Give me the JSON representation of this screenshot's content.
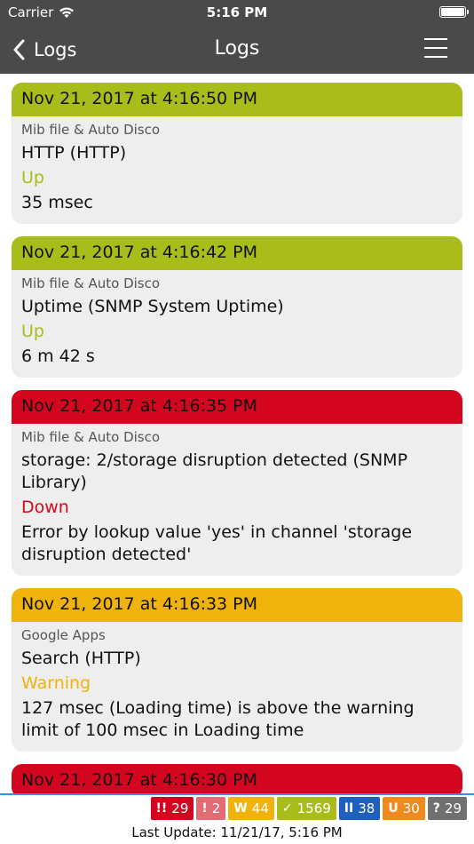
{
  "status_bar": {
    "carrier": "Carrier",
    "time": "5:16 PM"
  },
  "nav": {
    "back_label": "Logs",
    "title": "Logs"
  },
  "logs": [
    {
      "timestamp": "Nov 21, 2017 at 4:16:50 PM",
      "status": "up",
      "color": "#a8bc1a",
      "group": "Mib file & Auto Disco",
      "sensor": "HTTP (HTTP)",
      "state": "Up",
      "message": "35 msec"
    },
    {
      "timestamp": "Nov 21, 2017 at 4:16:42 PM",
      "status": "up",
      "color": "#a8bc1a",
      "group": "Mib file & Auto Disco",
      "sensor": "Uptime (SNMP System Uptime)",
      "state": "Up",
      "message": "6 m 42 s"
    },
    {
      "timestamp": "Nov 21, 2017 at 4:16:35 PM",
      "status": "down",
      "color": "#d4061f",
      "group": "Mib file & Auto Disco",
      "sensor": "storage: 2/storage disruption detected (SNMP Library)",
      "state": "Down",
      "message": "Error by lookup value 'yes' in channel 'storage disruption detected'"
    },
    {
      "timestamp": "Nov 21, 2017 at 4:16:33 PM",
      "status": "warning",
      "color": "#f0b30c",
      "group": "Google Apps",
      "sensor": "Search (HTTP)",
      "state": "Warning",
      "message": "127 msec (Loading time) is above the warning limit of 100 msec in Loading time"
    },
    {
      "timestamp": "Nov 21, 2017 at 4:16:30 PM",
      "status": "down",
      "color": "#d4061f"
    }
  ],
  "footer": {
    "badges": [
      {
        "icon": "!!",
        "count": "29",
        "color": "#d4061f",
        "name": "down"
      },
      {
        "icon": "!",
        "count": "2",
        "color": "#e36b73",
        "name": "down-acknowledged"
      },
      {
        "icon": "W",
        "count": "44",
        "color": "#f0b30c",
        "name": "warning"
      },
      {
        "icon": "✓",
        "count": "1569",
        "color": "#a8bc1a",
        "name": "up"
      },
      {
        "icon": "II",
        "count": "38",
        "color": "#1f5fbf",
        "name": "paused"
      },
      {
        "icon": "U",
        "count": "30",
        "color": "#f08a1c",
        "name": "unusual"
      },
      {
        "icon": "?",
        "count": "29",
        "color": "#707070",
        "name": "unknown"
      }
    ],
    "last_update": "Last Update: 11/21/17, 5:16 PM"
  }
}
